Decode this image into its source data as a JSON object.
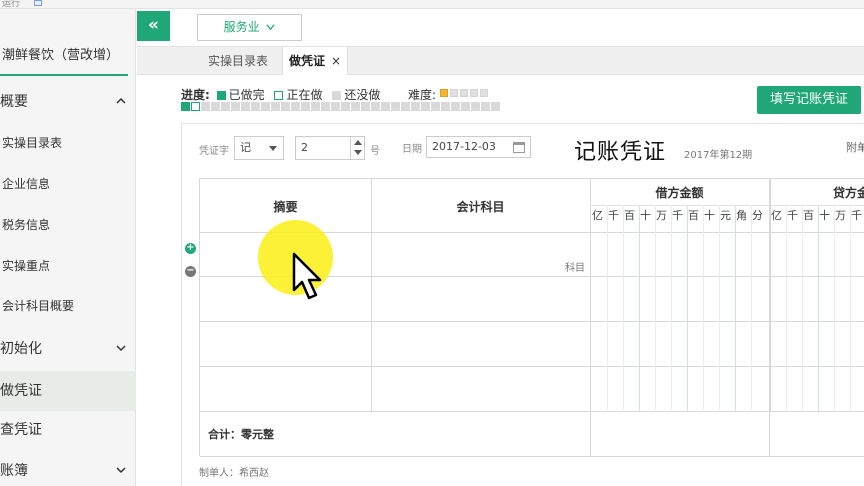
{
  "topstrip": {
    "text": "运行"
  },
  "sidebar": {
    "company": "潮鲜餐饮（营改增）",
    "items": [
      {
        "label": "概要",
        "type": "group",
        "expanded": true
      },
      {
        "label": "实操目录表",
        "type": "item"
      },
      {
        "label": "企业信息",
        "type": "item"
      },
      {
        "label": "税务信息",
        "type": "item"
      },
      {
        "label": "实操重点",
        "type": "item"
      },
      {
        "label": "会计科目概要",
        "type": "item"
      },
      {
        "label": "初始化",
        "type": "group",
        "expanded": false
      },
      {
        "label": "做凭证",
        "type": "group",
        "active": true
      },
      {
        "label": "查凭证",
        "type": "group"
      },
      {
        "label": "账簿",
        "type": "group",
        "expanded": false
      }
    ]
  },
  "header": {
    "collapse_label": "«",
    "industry": "服务业"
  },
  "tabs": [
    {
      "label": "实操目录表",
      "active": false
    },
    {
      "label": "做凭证",
      "active": true,
      "close": "×"
    }
  ],
  "status": {
    "progress_label": "进度:",
    "done_label": "已做完",
    "doing_label": "正在做",
    "todo_label": "还没做",
    "difficulty_label": "难度:",
    "difficulty_level": 1,
    "difficulty_max": 5,
    "progress_cells": [
      "done",
      "doing",
      "todo",
      "todo",
      "todo",
      "todo",
      "todo",
      "todo",
      "todo",
      "todo",
      "todo",
      "todo",
      "todo",
      "todo",
      "todo",
      "todo",
      "todo",
      "todo",
      "todo",
      "todo",
      "todo",
      "todo",
      "todo",
      "todo",
      "todo",
      "todo",
      "todo",
      "todo",
      "todo",
      "todo",
      "todo",
      "todo"
    ],
    "colors": {
      "done": "#1fa777",
      "doing": "#ffffff",
      "todo": "#d9d9d9",
      "accent": "#1fa777"
    }
  },
  "fill_button": "填写记账凭证",
  "voucher": {
    "type_label": "凭证字",
    "type_value": "记",
    "number_value": "2",
    "number_suffix": "号",
    "date_label": "日期",
    "date_value": "2017-12-03",
    "title": "记账凭证",
    "period": "2017年第12期",
    "attach_label": "附单"
  },
  "table": {
    "col_summary": "摘要",
    "col_subject": "会计科目",
    "col_debit": "借方金额",
    "col_credit": "贷方金",
    "debit_digits": [
      "亿",
      "千",
      "百",
      "十",
      "万",
      "千",
      "百",
      "十",
      "元",
      "角",
      "分"
    ],
    "credit_digits": [
      "亿",
      "千",
      "百",
      "十",
      "万",
      "千"
    ],
    "subject_placeholder": "科目",
    "total": "合计：零元整",
    "maker": "制单人：希西赵"
  }
}
